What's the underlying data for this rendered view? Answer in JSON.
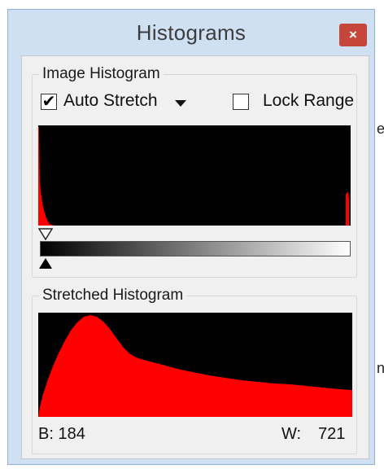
{
  "background_fragments": [
    "e",
    "n"
  ],
  "window": {
    "title": "Histograms",
    "close_label": "×"
  },
  "image_histogram": {
    "group_title": "Image Histogram",
    "auto_stretch": {
      "label": "Auto Stretch",
      "checked": true,
      "check_mark": "✔"
    },
    "lock_range": {
      "label": "Lock Range",
      "checked": false
    },
    "plot_color": "#ff0000"
  },
  "stretched_histogram": {
    "group_title": "Stretched Histogram",
    "plot_color": "#ff0000",
    "black_label": "B: 184",
    "white_label": "W:",
    "white_value": "721"
  }
}
